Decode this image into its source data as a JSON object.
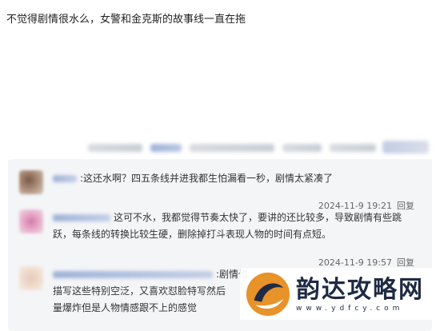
{
  "post": {
    "text": "不觉得剧情很水么，女警和金克斯的故事线一直在拖"
  },
  "comments": [
    {
      "prefix": ":",
      "text": "这还水啊？四五条线并进我都生怕漏看一秒，剧情太紧凑了",
      "time": "2024-11-9 19:21",
      "reply_label": "回复"
    },
    {
      "text": "这可不水，我都觉得节奏太快了，要讲的还比较多，导致剧情有些跳跃，每条线的转换比较生硬，删除掉打斗表现人物的时间有点短。",
      "time": "2024-11-9 19:57",
      "reply_label": "回复"
    },
    {
      "text_line1": ":剧情也",
      "text_line2": "描写这些特别空泛，又喜欢怼脸特写然后",
      "text_line3": "量爆炸但是人物情感跟不上的感觉"
    }
  ],
  "watermark": {
    "title": "韵达攻略网",
    "url": "www.ydfcy.com"
  },
  "colors": {
    "panel_bg": "#f4f5f7",
    "text": "#333333",
    "meta": "#666666"
  }
}
